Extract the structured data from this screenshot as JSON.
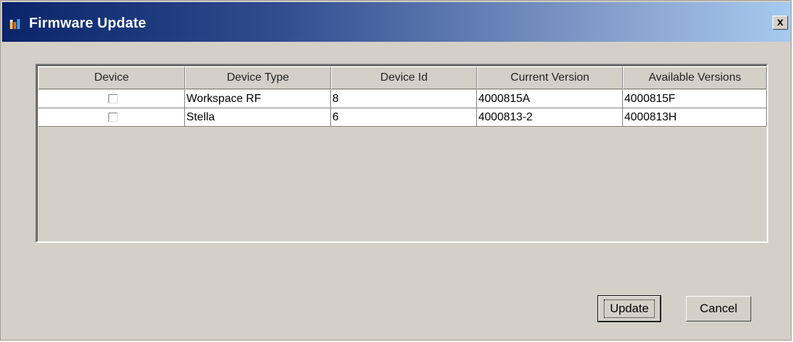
{
  "window": {
    "title": "Firmware Update",
    "close_label": "x"
  },
  "table": {
    "columns": [
      "Device",
      "Device Type",
      "Device Id",
      "Current Version",
      "Available Versions"
    ],
    "rows": [
      {
        "checked": false,
        "device_type": "Workspace RF",
        "device_id": "8",
        "current_version": "4000815A",
        "available_versions": "4000815F"
      },
      {
        "checked": false,
        "device_type": "Stella",
        "device_id": "6",
        "current_version": "4000813-2",
        "available_versions": "4000813H"
      }
    ]
  },
  "buttons": {
    "update_label": "Update",
    "cancel_label": "Cancel"
  },
  "icons": {
    "app_icon": "app-icon",
    "checkbox": "checkbox-unchecked"
  },
  "colors": {
    "title_start": "#0a246a",
    "title_end": "#a6caf0",
    "dialog_bg": "#d4d0c8"
  }
}
